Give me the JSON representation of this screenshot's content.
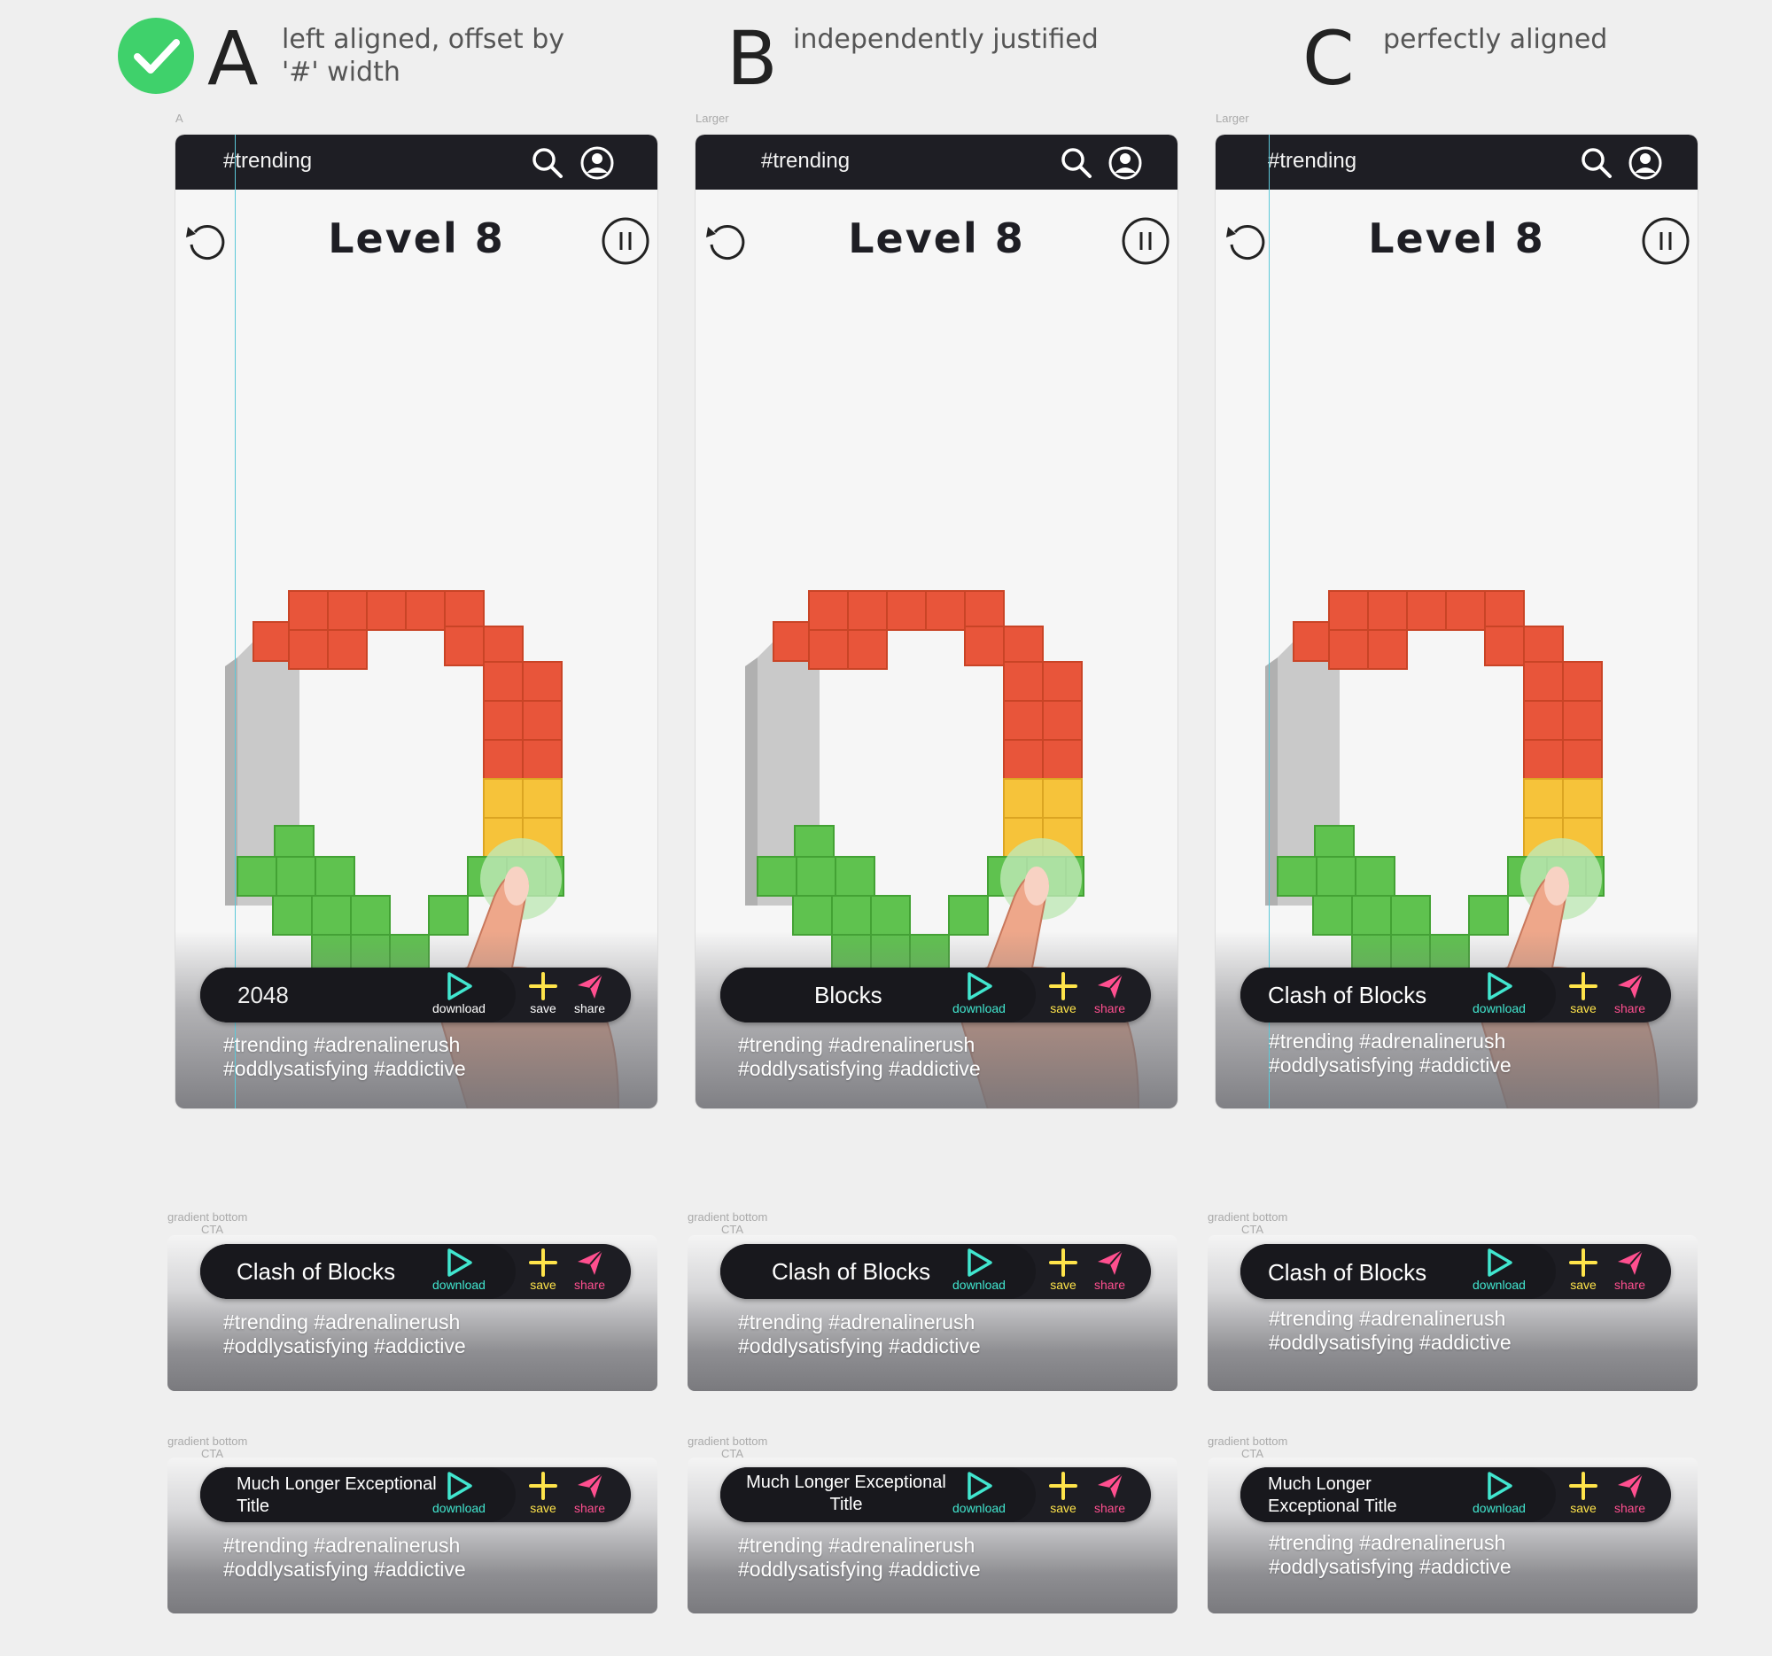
{
  "headers": [
    {
      "letter": "A",
      "desc1": "left aligned, offset by",
      "desc2": "'#' width",
      "approved": true
    },
    {
      "letter": "B",
      "desc1": "independently justified",
      "desc2": ""
    },
    {
      "letter": "C",
      "desc1": "perfectly aligned",
      "desc2": ""
    }
  ],
  "frame_labels": [
    "A",
    "Larger",
    "Larger"
  ],
  "phones": [
    {
      "topbar_title": "#trending",
      "level": "Level 8",
      "cta_title": "2048",
      "tags_line1": "#trending #adrenalinerush",
      "tags_line2": "#oddlysatisfying #addictive"
    },
    {
      "topbar_title": "#trending",
      "level": "Level 8",
      "cta_title": "Blocks",
      "tags_line1": "#trending #adrenalinerush",
      "tags_line2": "#oddlysatisfying #addictive"
    },
    {
      "topbar_title": "#trending",
      "level": "Level 8",
      "cta_title": "Clash of Blocks",
      "tags_line1": "#trending #adrenalinerush",
      "tags_line2": "#oddlysatisfying #addictive"
    }
  ],
  "actions": {
    "download": "download",
    "save": "save",
    "share": "share"
  },
  "card_label1": "gradient bottom",
  "card_label2": "CTA",
  "cards_row1": [
    {
      "title": "Clash of Blocks",
      "tags_line1": "#trending #adrenalinerush",
      "tags_line2": "#oddlysatisfying #addictive"
    },
    {
      "title": "Clash of Blocks",
      "tags_line1": "#trending #adrenalinerush",
      "tags_line2": "#oddlysatisfying #addictive"
    },
    {
      "title": "Clash of Blocks",
      "tags_line1": "#trending #adrenalinerush",
      "tags_line2": "#oddlysatisfying #addictive"
    }
  ],
  "cards_row2": [
    {
      "title_l1": "Much Longer Exceptional",
      "title_l2": "Title",
      "tags_line1": "#trending #adrenalinerush",
      "tags_line2": "#oddlysatisfying #addictive"
    },
    {
      "title_l1": "Much Longer Exceptional",
      "title_l2": "Title",
      "tags_line1": "#trending #adrenalinerush",
      "tags_line2": "#oddlysatisfying #addictive"
    },
    {
      "title_l1": "Much Longer",
      "title_l2": "Exceptional Title",
      "tags_line1": "#trending #adrenalinerush",
      "tags_line2": "#oddlysatisfying #addictive"
    }
  ],
  "colors": {
    "download": "#41e6cf",
    "save": "#ffe44a",
    "share": "#ff4f8f",
    "approved": "#3fd16b",
    "guide": "#5cc8d8"
  }
}
